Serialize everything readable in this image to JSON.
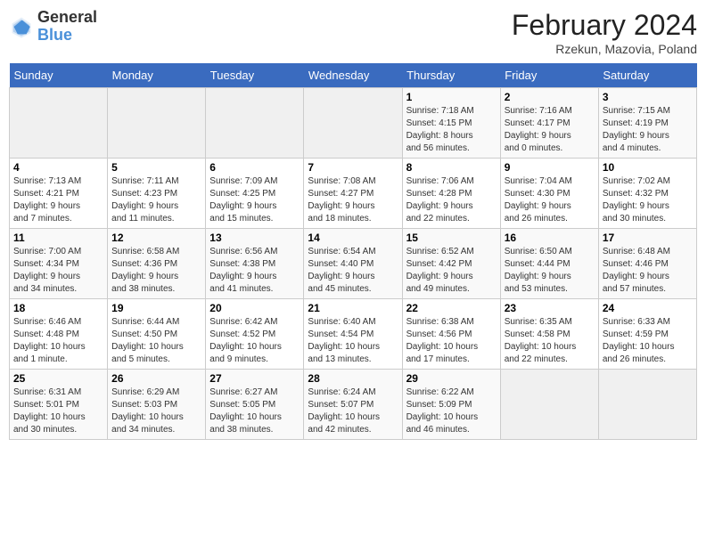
{
  "header": {
    "logo_line1": "General",
    "logo_line2": "Blue",
    "month": "February 2024",
    "location": "Rzekun, Mazovia, Poland"
  },
  "weekdays": [
    "Sunday",
    "Monday",
    "Tuesday",
    "Wednesday",
    "Thursday",
    "Friday",
    "Saturday"
  ],
  "weeks": [
    [
      {
        "day": "",
        "info": "",
        "empty": true
      },
      {
        "day": "",
        "info": "",
        "empty": true
      },
      {
        "day": "",
        "info": "",
        "empty": true
      },
      {
        "day": "",
        "info": "",
        "empty": true
      },
      {
        "day": "1",
        "info": "Sunrise: 7:18 AM\nSunset: 4:15 PM\nDaylight: 8 hours\nand 56 minutes.",
        "empty": false
      },
      {
        "day": "2",
        "info": "Sunrise: 7:16 AM\nSunset: 4:17 PM\nDaylight: 9 hours\nand 0 minutes.",
        "empty": false
      },
      {
        "day": "3",
        "info": "Sunrise: 7:15 AM\nSunset: 4:19 PM\nDaylight: 9 hours\nand 4 minutes.",
        "empty": false
      }
    ],
    [
      {
        "day": "4",
        "info": "Sunrise: 7:13 AM\nSunset: 4:21 PM\nDaylight: 9 hours\nand 7 minutes.",
        "empty": false
      },
      {
        "day": "5",
        "info": "Sunrise: 7:11 AM\nSunset: 4:23 PM\nDaylight: 9 hours\nand 11 minutes.",
        "empty": false
      },
      {
        "day": "6",
        "info": "Sunrise: 7:09 AM\nSunset: 4:25 PM\nDaylight: 9 hours\nand 15 minutes.",
        "empty": false
      },
      {
        "day": "7",
        "info": "Sunrise: 7:08 AM\nSunset: 4:27 PM\nDaylight: 9 hours\nand 18 minutes.",
        "empty": false
      },
      {
        "day": "8",
        "info": "Sunrise: 7:06 AM\nSunset: 4:28 PM\nDaylight: 9 hours\nand 22 minutes.",
        "empty": false
      },
      {
        "day": "9",
        "info": "Sunrise: 7:04 AM\nSunset: 4:30 PM\nDaylight: 9 hours\nand 26 minutes.",
        "empty": false
      },
      {
        "day": "10",
        "info": "Sunrise: 7:02 AM\nSunset: 4:32 PM\nDaylight: 9 hours\nand 30 minutes.",
        "empty": false
      }
    ],
    [
      {
        "day": "11",
        "info": "Sunrise: 7:00 AM\nSunset: 4:34 PM\nDaylight: 9 hours\nand 34 minutes.",
        "empty": false
      },
      {
        "day": "12",
        "info": "Sunrise: 6:58 AM\nSunset: 4:36 PM\nDaylight: 9 hours\nand 38 minutes.",
        "empty": false
      },
      {
        "day": "13",
        "info": "Sunrise: 6:56 AM\nSunset: 4:38 PM\nDaylight: 9 hours\nand 41 minutes.",
        "empty": false
      },
      {
        "day": "14",
        "info": "Sunrise: 6:54 AM\nSunset: 4:40 PM\nDaylight: 9 hours\nand 45 minutes.",
        "empty": false
      },
      {
        "day": "15",
        "info": "Sunrise: 6:52 AM\nSunset: 4:42 PM\nDaylight: 9 hours\nand 49 minutes.",
        "empty": false
      },
      {
        "day": "16",
        "info": "Sunrise: 6:50 AM\nSunset: 4:44 PM\nDaylight: 9 hours\nand 53 minutes.",
        "empty": false
      },
      {
        "day": "17",
        "info": "Sunrise: 6:48 AM\nSunset: 4:46 PM\nDaylight: 9 hours\nand 57 minutes.",
        "empty": false
      }
    ],
    [
      {
        "day": "18",
        "info": "Sunrise: 6:46 AM\nSunset: 4:48 PM\nDaylight: 10 hours\nand 1 minute.",
        "empty": false
      },
      {
        "day": "19",
        "info": "Sunrise: 6:44 AM\nSunset: 4:50 PM\nDaylight: 10 hours\nand 5 minutes.",
        "empty": false
      },
      {
        "day": "20",
        "info": "Sunrise: 6:42 AM\nSunset: 4:52 PM\nDaylight: 10 hours\nand 9 minutes.",
        "empty": false
      },
      {
        "day": "21",
        "info": "Sunrise: 6:40 AM\nSunset: 4:54 PM\nDaylight: 10 hours\nand 13 minutes.",
        "empty": false
      },
      {
        "day": "22",
        "info": "Sunrise: 6:38 AM\nSunset: 4:56 PM\nDaylight: 10 hours\nand 17 minutes.",
        "empty": false
      },
      {
        "day": "23",
        "info": "Sunrise: 6:35 AM\nSunset: 4:58 PM\nDaylight: 10 hours\nand 22 minutes.",
        "empty": false
      },
      {
        "day": "24",
        "info": "Sunrise: 6:33 AM\nSunset: 4:59 PM\nDaylight: 10 hours\nand 26 minutes.",
        "empty": false
      }
    ],
    [
      {
        "day": "25",
        "info": "Sunrise: 6:31 AM\nSunset: 5:01 PM\nDaylight: 10 hours\nand 30 minutes.",
        "empty": false
      },
      {
        "day": "26",
        "info": "Sunrise: 6:29 AM\nSunset: 5:03 PM\nDaylight: 10 hours\nand 34 minutes.",
        "empty": false
      },
      {
        "day": "27",
        "info": "Sunrise: 6:27 AM\nSunset: 5:05 PM\nDaylight: 10 hours\nand 38 minutes.",
        "empty": false
      },
      {
        "day": "28",
        "info": "Sunrise: 6:24 AM\nSunset: 5:07 PM\nDaylight: 10 hours\nand 42 minutes.",
        "empty": false
      },
      {
        "day": "29",
        "info": "Sunrise: 6:22 AM\nSunset: 5:09 PM\nDaylight: 10 hours\nand 46 minutes.",
        "empty": false
      },
      {
        "day": "",
        "info": "",
        "empty": true
      },
      {
        "day": "",
        "info": "",
        "empty": true
      }
    ]
  ]
}
